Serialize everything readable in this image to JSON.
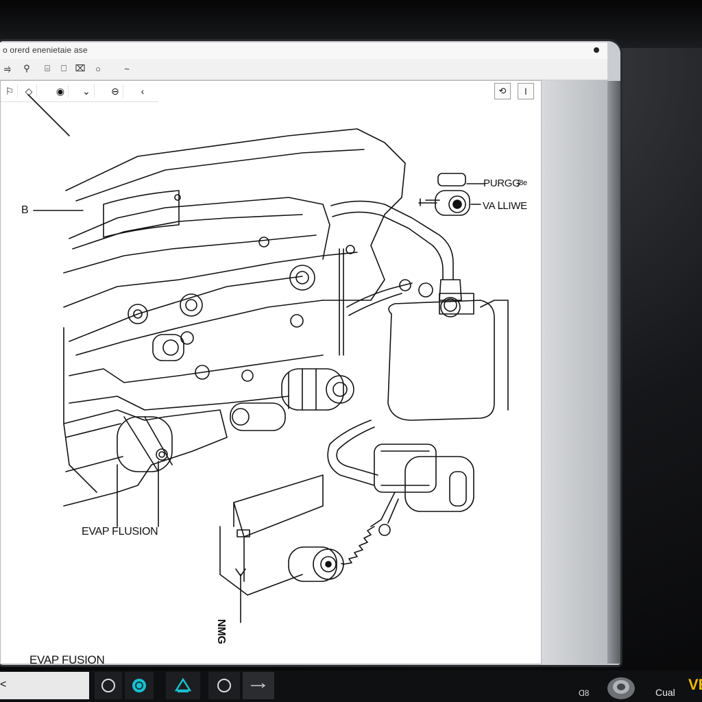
{
  "window": {
    "title": "o orerd enenietaie ase"
  },
  "toolbar": {
    "items": [
      {
        "name": "collapse-icon",
        "glyph": "⥤"
      },
      {
        "name": "pin-icon",
        "glyph": "⚲"
      },
      {
        "name": "clip-icon",
        "glyph": "⌸"
      },
      {
        "name": "page-icon",
        "glyph": "⎕"
      },
      {
        "name": "bookmark-icon",
        "glyph": "⌧"
      },
      {
        "name": "zoom-icon",
        "glyph": "○"
      },
      {
        "name": "draw-icon",
        "glyph": "~"
      }
    ]
  },
  "doc_toolbar": {
    "left": [
      {
        "name": "person-icon",
        "glyph": "⚐"
      },
      {
        "name": "link-icon",
        "glyph": "◇"
      },
      {
        "name": "eye-icon",
        "glyph": "◉"
      },
      {
        "name": "filter-icon",
        "glyph": "⌄"
      },
      {
        "name": "stop-icon",
        "glyph": "⊖"
      },
      {
        "name": "back-icon",
        "glyph": "‹"
      }
    ],
    "right": [
      {
        "name": "refresh-icon",
        "glyph": "⟲"
      },
      {
        "name": "info-icon",
        "glyph": "ǀ"
      }
    ]
  },
  "diagram": {
    "labels": {
      "b": "B",
      "purge": "PURGG",
      "purge_suffix": "ʃ8e",
      "valve": "VA ᒪLIWE",
      "evap_fusion_left": "EVAP FLUSION",
      "nmg": "NMG",
      "evap_fusion_bottom": "EVAP FUSION"
    }
  },
  "taskbar": {
    "left_glyph": "<",
    "tray_text": "Ɑ8",
    "brand": "Cual",
    "brand_logo": "VE"
  }
}
